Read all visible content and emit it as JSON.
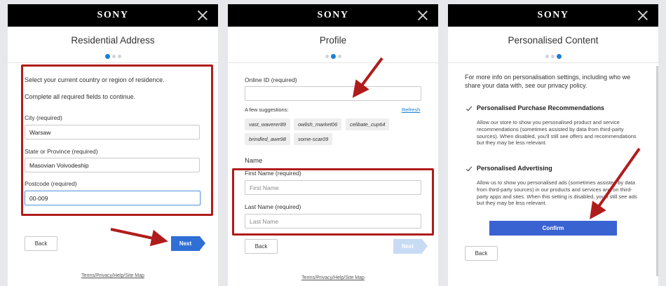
{
  "brand": "SONY",
  "panel1": {
    "title": "Residential Address",
    "intro1": "Select your current country or region of residence.",
    "intro2": "Complete all required fields to continue.",
    "city_label": "City (required)",
    "city_value": "Warsaw",
    "state_label": "State or Province (required)",
    "state_value": "Masovian Voivodeship",
    "postcode_label": "Postcode (required)",
    "postcode_value": "00-009",
    "back_label": "Back",
    "next_label": "Next",
    "footer": "Terms/Privacy/Help/Site Map"
  },
  "panel2": {
    "title": "Profile",
    "online_id_label": "Online ID (required)",
    "online_id_value": "",
    "suggestions_label": "A few suggestions:",
    "refresh_label": "Refresh",
    "suggestions": [
      "vast_waverer89",
      "owlish_market06",
      "celibate_cup64",
      "brindled_awe98",
      "some-scar09"
    ],
    "name_heading": "Name",
    "first_name_label": "First Name (required)",
    "first_name_placeholder": "First Name",
    "last_name_label": "Last Name (required)",
    "last_name_placeholder": "Last Name",
    "back_label": "Back",
    "next_label": "Next",
    "footer": "Terms/Privacy/Help/Site Map"
  },
  "panel3": {
    "title": "Personalised Content",
    "intro": "For more info on personalisation settings, including who we share your data with, see our privacy policy.",
    "opt1_title": "Personalised Purchase Recommendations",
    "opt1_desc": "Allow our store to show you personalised product and service recommendations (sometimes assisted by data from third-party sources). When disabled, you'll still see offers and recommendations but they may be less relevant.",
    "opt2_title": "Personalised Advertising",
    "opt2_desc": "Allow us to show you personalised ads (sometimes assisted by data from third-party sources) in our products and services and on third-party apps and sites. When this setting is disabled, you'll still see ads but they may be less relevant.",
    "confirm_label": "Confirm",
    "back_label": "Back"
  },
  "colors": {
    "accent_blue": "#2f6fd6",
    "highlight_red": "#b01c1c",
    "header_black": "#000000"
  }
}
